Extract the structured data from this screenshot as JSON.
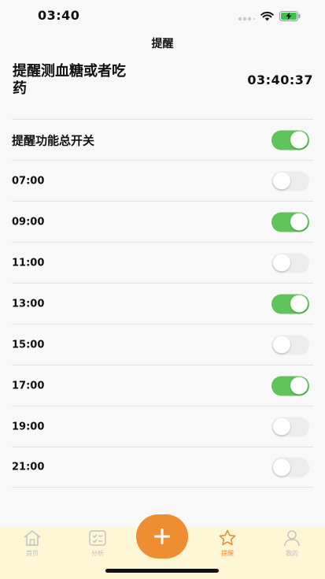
{
  "status": {
    "time": "03:40"
  },
  "nav": {
    "title": "提醒"
  },
  "header": {
    "text": "提醒测血糖或者吃药",
    "clock": "03:40:37"
  },
  "master": {
    "label": "提醒功能总开关",
    "on": true
  },
  "reminders": [
    {
      "time": "07:00",
      "on": false
    },
    {
      "time": "09:00",
      "on": true
    },
    {
      "time": "11:00",
      "on": false
    },
    {
      "time": "13:00",
      "on": true
    },
    {
      "time": "15:00",
      "on": false
    },
    {
      "time": "17:00",
      "on": true
    },
    {
      "time": "19:00",
      "on": false
    },
    {
      "time": "21:00",
      "on": false
    }
  ],
  "tabs": [
    {
      "label": "首页",
      "icon": "home-icon"
    },
    {
      "label": "分析",
      "icon": "analysis-icon"
    },
    {
      "label": "提醒",
      "icon": "star-icon",
      "active": true
    },
    {
      "label": "我的",
      "icon": "profile-icon"
    }
  ],
  "colors": {
    "accent": "#ef8d32",
    "toggle_on": "#5fc45b",
    "tab_bar": "#fdf7d6"
  }
}
